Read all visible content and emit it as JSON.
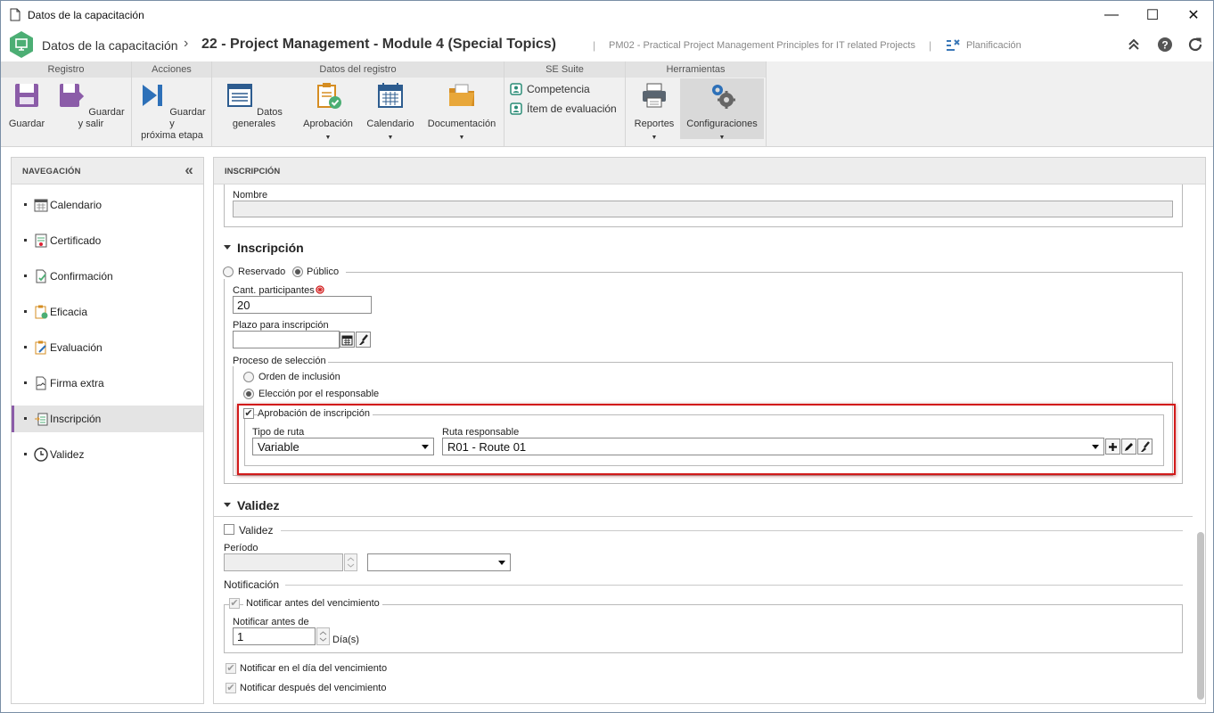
{
  "window": {
    "title": "Datos de la capacitación",
    "minimize": "—",
    "maximize": "☐",
    "close": "✕"
  },
  "header": {
    "app": "Datos de la capacitación",
    "sep": "›",
    "record": "22 - Project Management - Module 4 (Special Topics)",
    "course": "PM02 - Practical Project Management Principles for IT related Projects",
    "planning": "Planificación"
  },
  "ribbon": {
    "groups": {
      "registro": "Registro",
      "acciones": "Acciones",
      "datos": "Datos del registro",
      "suite": "SE Suite",
      "herramientas": "Herramientas"
    },
    "guardar": "Guardar",
    "guardar_salir": "Guardar y salir",
    "guardar_prox_1": "Guardar y",
    "guardar_prox_2": "próxima etapa",
    "datos_generales": "Datos generales",
    "aprobacion": "Aprobación",
    "calendario": "Calendario",
    "documentacion": "Documentación",
    "competencia": "Competencia",
    "item_evaluacion": "Ítem de evaluación",
    "reportes": "Reportes",
    "configuraciones": "Configuraciones"
  },
  "nav": {
    "title": "NAVEGACIÓN",
    "collapse": "«",
    "items": [
      "Calendario",
      "Certificado",
      "Confirmación",
      "Eficacia",
      "Evaluación",
      "Firma extra",
      "Inscripción",
      "Validez"
    ],
    "active_index": 6
  },
  "main": {
    "title": "INSCRIPCIÓN",
    "nombre_label": "Nombre",
    "nombre_value": "",
    "inscripcion": {
      "section": "Inscripción",
      "reservado": "Reservado",
      "publico": "Público",
      "cant_label": "Cant. participantes",
      "cant_value": "20",
      "plazo_label": "Plazo para inscripción",
      "plazo_value": "",
      "proceso_label": "Proceso de selección",
      "orden": "Orden de inclusión",
      "eleccion": "Elección por el responsable",
      "aprobacion_label": "Aprobación de inscripción",
      "tipo_ruta_label": "Tipo de ruta",
      "tipo_ruta_value": "Variable",
      "ruta_resp_label": "Ruta responsable",
      "ruta_resp_value": "R01 - Route 01"
    },
    "validez": {
      "section": "Validez",
      "validez_chk": "Validez",
      "periodo_label": "Período",
      "periodo_value": "",
      "periodo_unit": "",
      "notificacion": "Notificación",
      "notif_antes": "Notificar antes del vencimiento",
      "notif_antes_de": "Notificar antes de",
      "notif_antes_value": "1",
      "dias": "Día(s)",
      "notif_dia": "Notificar en el día del vencimiento",
      "notif_despues": "Notificar después del vencimiento"
    }
  },
  "colors": {
    "accent": "#4cae74",
    "highlight": "#d21a1a",
    "ribbon_bg": "#f0f0f0",
    "active_nav": "#8b5ca8"
  }
}
